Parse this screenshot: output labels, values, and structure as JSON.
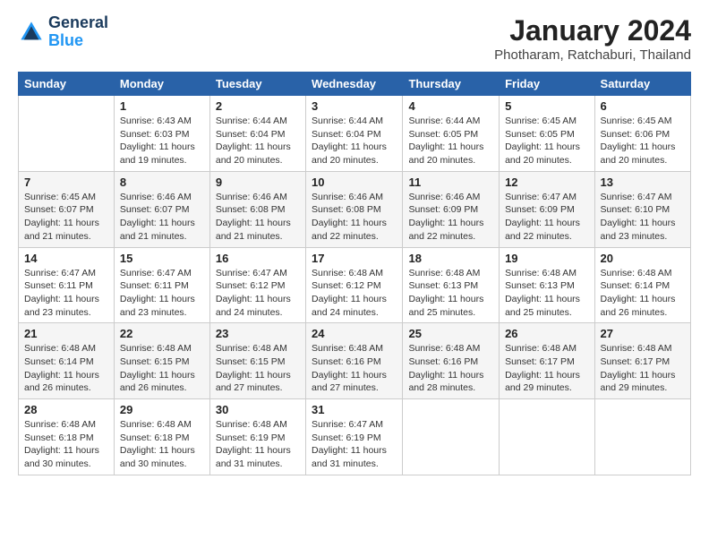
{
  "header": {
    "logo_line1": "General",
    "logo_line2": "Blue",
    "month": "January 2024",
    "location": "Photharam, Ratchaburi, Thailand"
  },
  "days_of_week": [
    "Sunday",
    "Monday",
    "Tuesday",
    "Wednesday",
    "Thursday",
    "Friday",
    "Saturday"
  ],
  "weeks": [
    [
      {
        "num": "",
        "detail": ""
      },
      {
        "num": "1",
        "detail": "Sunrise: 6:43 AM\nSunset: 6:03 PM\nDaylight: 11 hours\nand 19 minutes."
      },
      {
        "num": "2",
        "detail": "Sunrise: 6:44 AM\nSunset: 6:04 PM\nDaylight: 11 hours\nand 20 minutes."
      },
      {
        "num": "3",
        "detail": "Sunrise: 6:44 AM\nSunset: 6:04 PM\nDaylight: 11 hours\nand 20 minutes."
      },
      {
        "num": "4",
        "detail": "Sunrise: 6:44 AM\nSunset: 6:05 PM\nDaylight: 11 hours\nand 20 minutes."
      },
      {
        "num": "5",
        "detail": "Sunrise: 6:45 AM\nSunset: 6:05 PM\nDaylight: 11 hours\nand 20 minutes."
      },
      {
        "num": "6",
        "detail": "Sunrise: 6:45 AM\nSunset: 6:06 PM\nDaylight: 11 hours\nand 20 minutes."
      }
    ],
    [
      {
        "num": "7",
        "detail": "Sunrise: 6:45 AM\nSunset: 6:07 PM\nDaylight: 11 hours\nand 21 minutes."
      },
      {
        "num": "8",
        "detail": "Sunrise: 6:46 AM\nSunset: 6:07 PM\nDaylight: 11 hours\nand 21 minutes."
      },
      {
        "num": "9",
        "detail": "Sunrise: 6:46 AM\nSunset: 6:08 PM\nDaylight: 11 hours\nand 21 minutes."
      },
      {
        "num": "10",
        "detail": "Sunrise: 6:46 AM\nSunset: 6:08 PM\nDaylight: 11 hours\nand 22 minutes."
      },
      {
        "num": "11",
        "detail": "Sunrise: 6:46 AM\nSunset: 6:09 PM\nDaylight: 11 hours\nand 22 minutes."
      },
      {
        "num": "12",
        "detail": "Sunrise: 6:47 AM\nSunset: 6:09 PM\nDaylight: 11 hours\nand 22 minutes."
      },
      {
        "num": "13",
        "detail": "Sunrise: 6:47 AM\nSunset: 6:10 PM\nDaylight: 11 hours\nand 23 minutes."
      }
    ],
    [
      {
        "num": "14",
        "detail": "Sunrise: 6:47 AM\nSunset: 6:11 PM\nDaylight: 11 hours\nand 23 minutes."
      },
      {
        "num": "15",
        "detail": "Sunrise: 6:47 AM\nSunset: 6:11 PM\nDaylight: 11 hours\nand 23 minutes."
      },
      {
        "num": "16",
        "detail": "Sunrise: 6:47 AM\nSunset: 6:12 PM\nDaylight: 11 hours\nand 24 minutes."
      },
      {
        "num": "17",
        "detail": "Sunrise: 6:48 AM\nSunset: 6:12 PM\nDaylight: 11 hours\nand 24 minutes."
      },
      {
        "num": "18",
        "detail": "Sunrise: 6:48 AM\nSunset: 6:13 PM\nDaylight: 11 hours\nand 25 minutes."
      },
      {
        "num": "19",
        "detail": "Sunrise: 6:48 AM\nSunset: 6:13 PM\nDaylight: 11 hours\nand 25 minutes."
      },
      {
        "num": "20",
        "detail": "Sunrise: 6:48 AM\nSunset: 6:14 PM\nDaylight: 11 hours\nand 26 minutes."
      }
    ],
    [
      {
        "num": "21",
        "detail": "Sunrise: 6:48 AM\nSunset: 6:14 PM\nDaylight: 11 hours\nand 26 minutes."
      },
      {
        "num": "22",
        "detail": "Sunrise: 6:48 AM\nSunset: 6:15 PM\nDaylight: 11 hours\nand 26 minutes."
      },
      {
        "num": "23",
        "detail": "Sunrise: 6:48 AM\nSunset: 6:15 PM\nDaylight: 11 hours\nand 27 minutes."
      },
      {
        "num": "24",
        "detail": "Sunrise: 6:48 AM\nSunset: 6:16 PM\nDaylight: 11 hours\nand 27 minutes."
      },
      {
        "num": "25",
        "detail": "Sunrise: 6:48 AM\nSunset: 6:16 PM\nDaylight: 11 hours\nand 28 minutes."
      },
      {
        "num": "26",
        "detail": "Sunrise: 6:48 AM\nSunset: 6:17 PM\nDaylight: 11 hours\nand 29 minutes."
      },
      {
        "num": "27",
        "detail": "Sunrise: 6:48 AM\nSunset: 6:17 PM\nDaylight: 11 hours\nand 29 minutes."
      }
    ],
    [
      {
        "num": "28",
        "detail": "Sunrise: 6:48 AM\nSunset: 6:18 PM\nDaylight: 11 hours\nand 30 minutes."
      },
      {
        "num": "29",
        "detail": "Sunrise: 6:48 AM\nSunset: 6:18 PM\nDaylight: 11 hours\nand 30 minutes."
      },
      {
        "num": "30",
        "detail": "Sunrise: 6:48 AM\nSunset: 6:19 PM\nDaylight: 11 hours\nand 31 minutes."
      },
      {
        "num": "31",
        "detail": "Sunrise: 6:47 AM\nSunset: 6:19 PM\nDaylight: 11 hours\nand 31 minutes."
      },
      {
        "num": "",
        "detail": ""
      },
      {
        "num": "",
        "detail": ""
      },
      {
        "num": "",
        "detail": ""
      }
    ]
  ]
}
